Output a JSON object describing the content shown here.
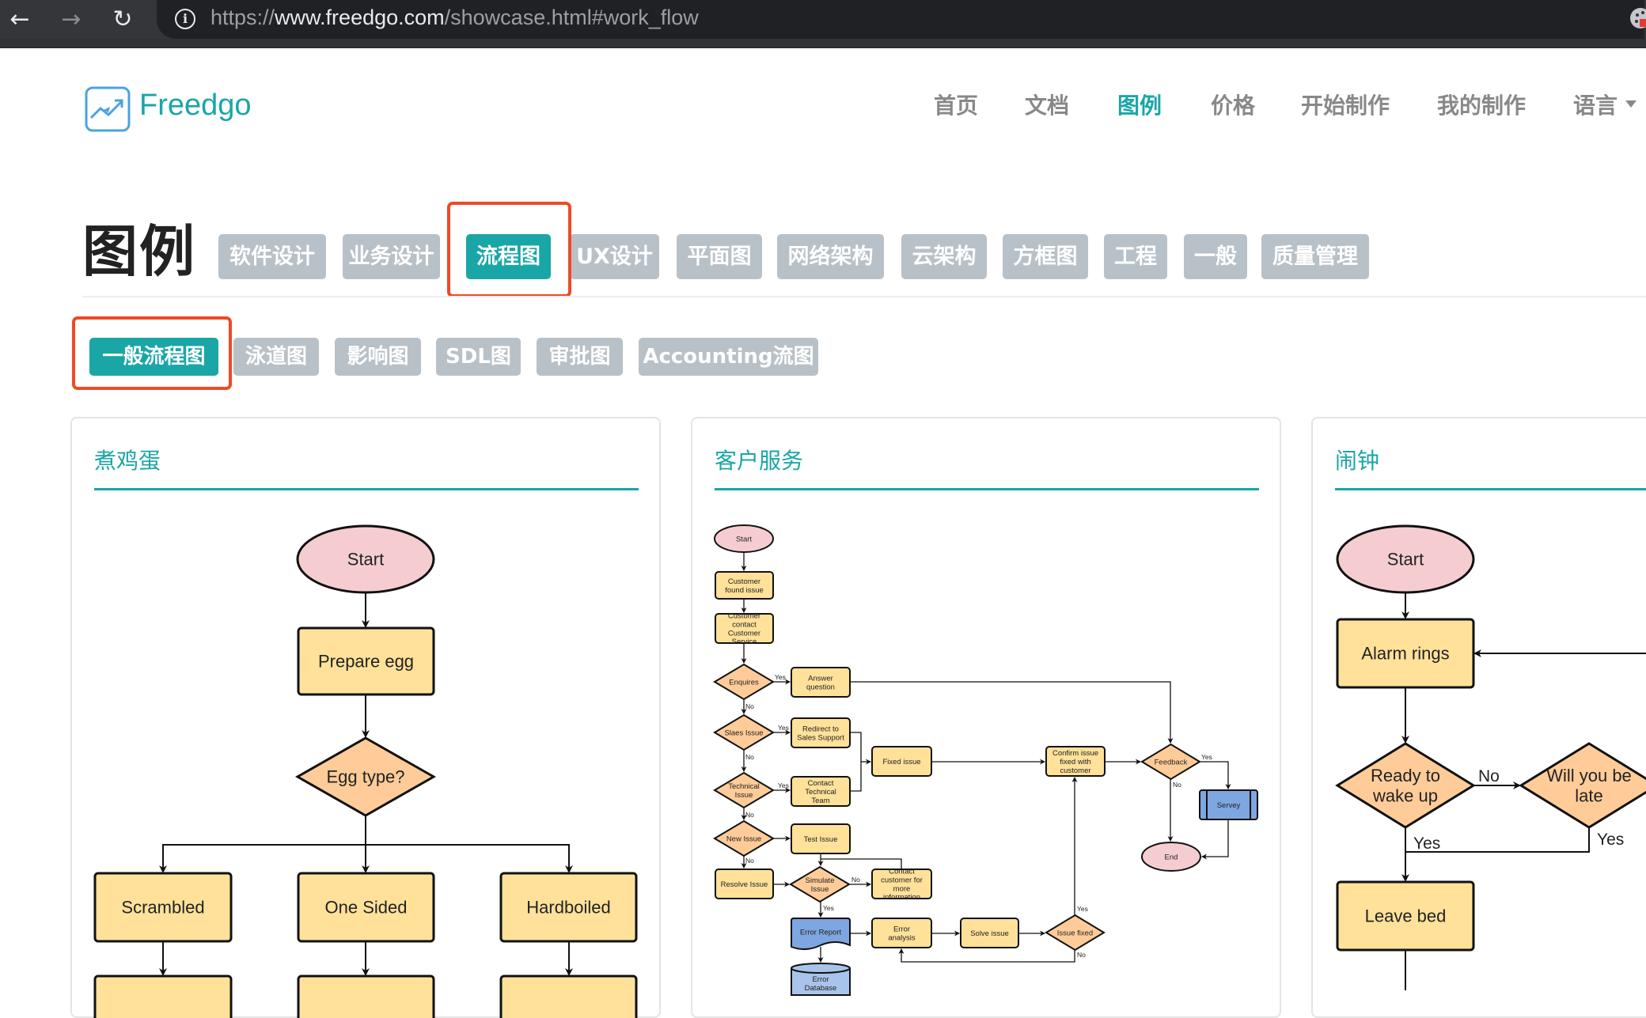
{
  "browser": {
    "url_scheme": "https://",
    "url_host": "www.freedgo.com",
    "url_path": "/showcase.html#work_flow",
    "back_icon": "arrow-left-icon",
    "forward_icon": "arrow-right-icon",
    "reload_icon": "reload-icon",
    "site_info_icon": "info-icon",
    "extension_icon": "cookie-extension-icon"
  },
  "header": {
    "brand": "Freedgo",
    "logo_icon": "trend-chart-icon",
    "nav": [
      {
        "label": "首页",
        "active": false
      },
      {
        "label": "文档",
        "active": false
      },
      {
        "label": "图例",
        "active": true
      },
      {
        "label": "价格",
        "active": false
      },
      {
        "label": "开始制作",
        "active": false
      },
      {
        "label": "我的制作",
        "active": false
      },
      {
        "label": "语言",
        "active": false,
        "dropdown": true
      }
    ]
  },
  "page": {
    "title": "图例",
    "categories": [
      {
        "label": "软件设计",
        "active": false
      },
      {
        "label": "业务设计",
        "active": false
      },
      {
        "label": "流程图",
        "active": true,
        "highlighted": true
      },
      {
        "label": "UX设计",
        "active": false
      },
      {
        "label": "平面图",
        "active": false
      },
      {
        "label": "网络架构",
        "active": false
      },
      {
        "label": "云架构",
        "active": false
      },
      {
        "label": "方框图",
        "active": false
      },
      {
        "label": "工程",
        "active": false
      },
      {
        "label": "一般",
        "active": false
      },
      {
        "label": "质量管理",
        "active": false
      }
    ],
    "subcategories": [
      {
        "label": "一般流程图",
        "active": true,
        "highlighted": true
      },
      {
        "label": "泳道图",
        "active": false
      },
      {
        "label": "影响图",
        "active": false
      },
      {
        "label": "SDL图",
        "active": false
      },
      {
        "label": "审批图",
        "active": false
      },
      {
        "label": "Accounting流图",
        "active": false
      }
    ],
    "colors": {
      "accent": "#1aa6a6",
      "tab_inactive": "#b8c1c7",
      "highlight_box": "#f04a24",
      "process_fill": "#ffe19a",
      "decision_fill": "#ffcc99",
      "terminal_fill": "#f5cdd0",
      "data_fill": "#7ea6e0"
    }
  },
  "cards": [
    {
      "title": "煮鸡蛋",
      "nodes": {
        "start": "Start",
        "prepare": "Prepare egg",
        "type": "Egg type?",
        "scrambled": "Scrambled",
        "onesided": "One Sided",
        "hardboiled": "Hardboiled"
      }
    },
    {
      "title": "客户服务",
      "nodes": {
        "start": "Start",
        "found": "Customer found issue",
        "contact": "Customer contact Customer Service",
        "enquires": "Enquires",
        "answer": "Answer question",
        "sales": "Slaes Issue",
        "redirect": "Redirect to Sales Support",
        "fixed": "Fixed issue",
        "technical": "Technical Issue",
        "techteam": "Contact Technical Team",
        "newissue": "New Issue",
        "test": "Test Issue",
        "resolve": "Resolve Issue",
        "simulate": "Simulate Issue",
        "moreinfo": "Contact customer for more information",
        "report": "Error Report",
        "database": "Error Database",
        "analysis": "Error analysis",
        "solve": "Solve issue",
        "issuefixed": "Issue fixed",
        "confirm": "Confirm issue fixed with customer",
        "feedback": "Feedback",
        "servey": "Servey",
        "end": "End"
      },
      "edge_labels": {
        "yes": "Yes",
        "no": "No"
      }
    },
    {
      "title": "闹钟",
      "nodes": {
        "start": "Start",
        "alarm": "Alarm rings",
        "ready": "Ready to wake up",
        "late": "Will you be late",
        "leave": "Leave bed"
      },
      "edge_labels": {
        "yes": "Yes",
        "no": "No"
      }
    }
  ]
}
